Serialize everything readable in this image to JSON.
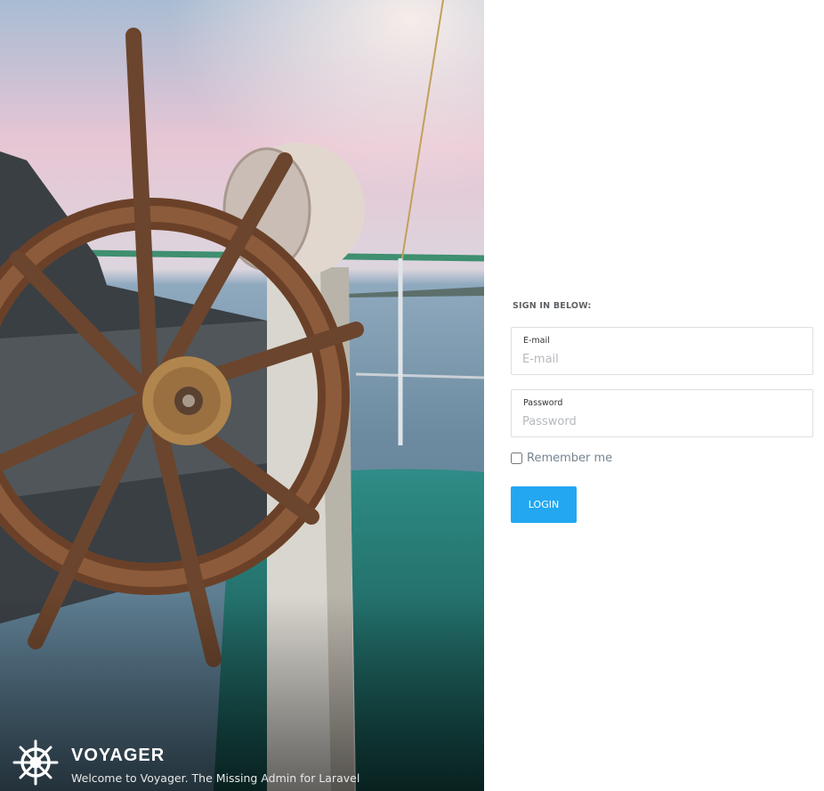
{
  "hero": {
    "image": "ship-steering-wheel-photo",
    "brand": {
      "logo_icon": "ship-wheel-icon",
      "title": "VOYAGER",
      "subtitle": "Welcome to Voyager. The Missing Admin for Laravel"
    }
  },
  "login": {
    "heading": "SIGN IN BELOW:",
    "email": {
      "label": "E-mail",
      "placeholder": "E-mail",
      "value": ""
    },
    "password": {
      "label": "Password",
      "placeholder": "Password",
      "value": ""
    },
    "remember": {
      "label": "Remember me",
      "checked": false
    },
    "submit_label": "LOGIN"
  },
  "colors": {
    "accent": "#22a7f0",
    "muted_text": "#76838f",
    "border": "#dcdfe3"
  }
}
